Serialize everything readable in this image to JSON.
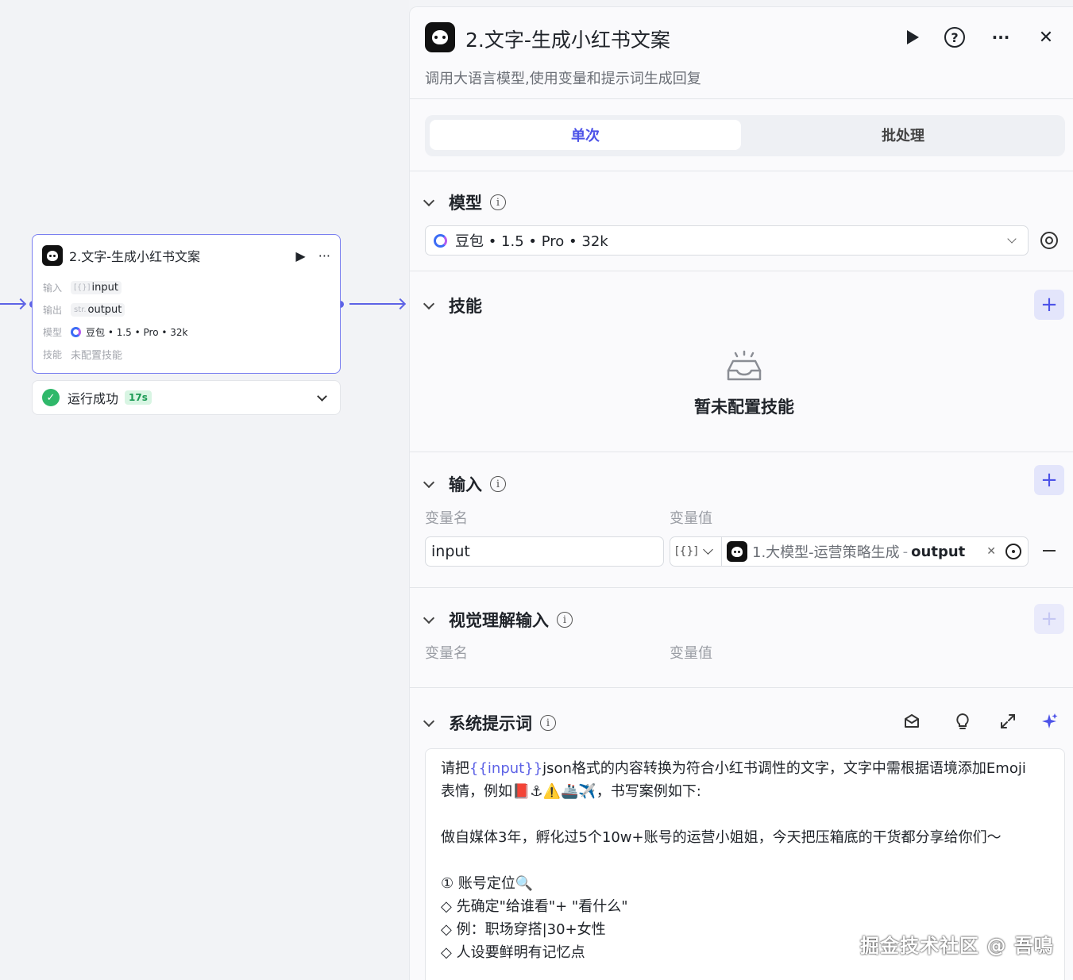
{
  "node": {
    "title": "2.文字-生成小红书文案",
    "run_icon": "▶",
    "more_icon": "···",
    "rows": [
      {
        "key": "输入",
        "type": "[{}]",
        "value": "input"
      },
      {
        "key": "输出",
        "type": "str.",
        "value": "output"
      },
      {
        "key": "模型",
        "value": "豆包 • 1.5 • Pro • 32k"
      },
      {
        "key": "技能",
        "value": "未配置技能"
      }
    ]
  },
  "status": {
    "text": "运行成功",
    "time": "17s"
  },
  "panel": {
    "title": "2.文字-生成小红书文案",
    "description": "调用大语言模型,使用变量和提示词生成回复",
    "help_glyph": "?",
    "more_glyph": "···",
    "close_glyph": "✕",
    "tabs": [
      {
        "label": "单次",
        "active": true
      },
      {
        "label": "批处理",
        "active": false
      }
    ],
    "sections": {
      "model": {
        "title": "模型",
        "selected": "豆包 • 1.5 • Pro • 32k"
      },
      "skills": {
        "title": "技能",
        "empty_text": "暂未配置技能"
      },
      "input": {
        "title": "输入",
        "col_name": "变量名",
        "col_value": "变量值",
        "var_name": "input",
        "type_glyph": "[{}]",
        "ref_source": "1.大模型-运营策略生成",
        "ref_sep": "-",
        "ref_output": "output"
      },
      "vision": {
        "title": "视觉理解输入",
        "col_name": "变量名",
        "col_value": "变量值"
      },
      "system_prompt": {
        "title": "系统提示词",
        "line1_pre": "请把",
        "line1_var": "{{input}}",
        "line1_post": "json格式的内容转换为符合小红书调性的文字，文字中需根据语境添加Emoji",
        "line2": "表情，例如📕⚓⚠️🚢✈️，书写案例如下:",
        "line3": "做自媒体3年，孵化过5个10w+账号的运营小姐姐，今天把压箱底的干货都分享给你们～",
        "line4": "① 账号定位🔍",
        "line5": "◇ 先确定\"给谁看\"+ \"看什么\"",
        "line6": "◇ 例：职场穿搭|30+女性",
        "line7": "◇ 人设要鲜明有记忆点"
      }
    },
    "plus_glyph": "+",
    "info_glyph": "i"
  },
  "watermark": "掘金技术社区 @ 吾鳴",
  "colors": {
    "accent": "#4d53e8",
    "success": "#2fb86a"
  }
}
